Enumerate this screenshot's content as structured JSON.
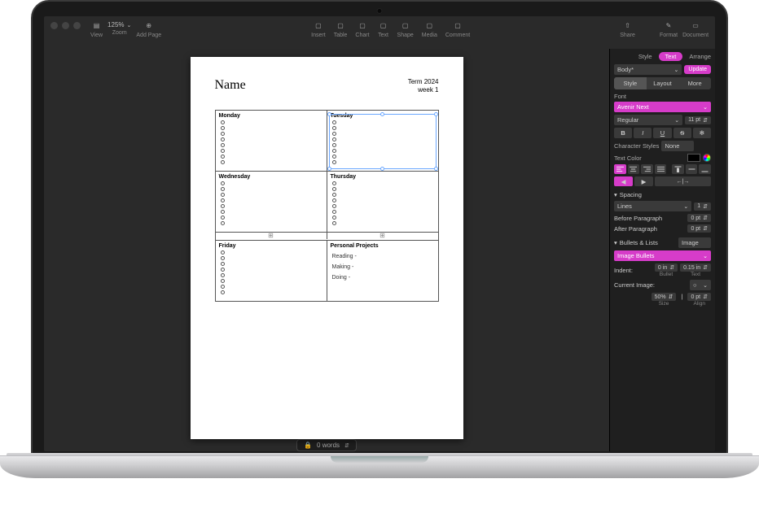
{
  "toolbar": {
    "zoom": "125%",
    "view": "View",
    "zoom_label": "Zoom",
    "addpage": "Add Page",
    "center": [
      {
        "id": "insert",
        "label": "Insert"
      },
      {
        "id": "table",
        "label": "Table"
      },
      {
        "id": "chart",
        "label": "Chart"
      },
      {
        "id": "text",
        "label": "Text"
      },
      {
        "id": "shape",
        "label": "Shape"
      },
      {
        "id": "media",
        "label": "Media"
      },
      {
        "id": "comment",
        "label": "Comment"
      }
    ],
    "share": "Share",
    "format": "Format",
    "document": "Document"
  },
  "document": {
    "name_label": "Name",
    "term": "Term 2024",
    "week": "week 1",
    "days": {
      "mon": "Monday",
      "tue": "Tuesday",
      "wed": "Wednesday",
      "thu": "Thursday",
      "fri": "Friday",
      "projects": "Personal Projects"
    },
    "projects": {
      "reading": "Reading -",
      "making": "Making -",
      "doing": "Doing -"
    }
  },
  "statusbar": {
    "words": "0 words"
  },
  "inspector": {
    "tabs": {
      "style": "Style",
      "text": "Text",
      "arrange": "Arrange"
    },
    "para_style": "Body*",
    "update": "Update",
    "seg": {
      "style": "Style",
      "layout": "Layout",
      "more": "More"
    },
    "font_label": "Font",
    "font_family": "Avenir Next",
    "font_weight": "Regular",
    "font_size": "11 pt",
    "fmt": {
      "b": "B",
      "i": "I",
      "u": "U",
      "s": "S"
    },
    "char_styles": "Character Styles",
    "char_styles_val": "None",
    "text_color": "Text Color",
    "spacing": {
      "title": "Spacing",
      "lines": "Lines",
      "lines_val": "1",
      "before": "Before Paragraph",
      "before_val": "0 pt",
      "after": "After Paragraph",
      "after_val": "0 pt"
    },
    "bullets": {
      "title": "Bullets & Lists",
      "style": "Image",
      "image_bullets": "Image Bullets",
      "indent": "Indent:",
      "bullet_indent": "0 in",
      "text_indent": "0.15 in",
      "bullet_lbl": "Bullet",
      "text_lbl": "Text",
      "current_image": "Current Image:",
      "size": "50%",
      "size_lbl": "Size",
      "align": "0 pt",
      "align_lbl": "Align"
    }
  }
}
